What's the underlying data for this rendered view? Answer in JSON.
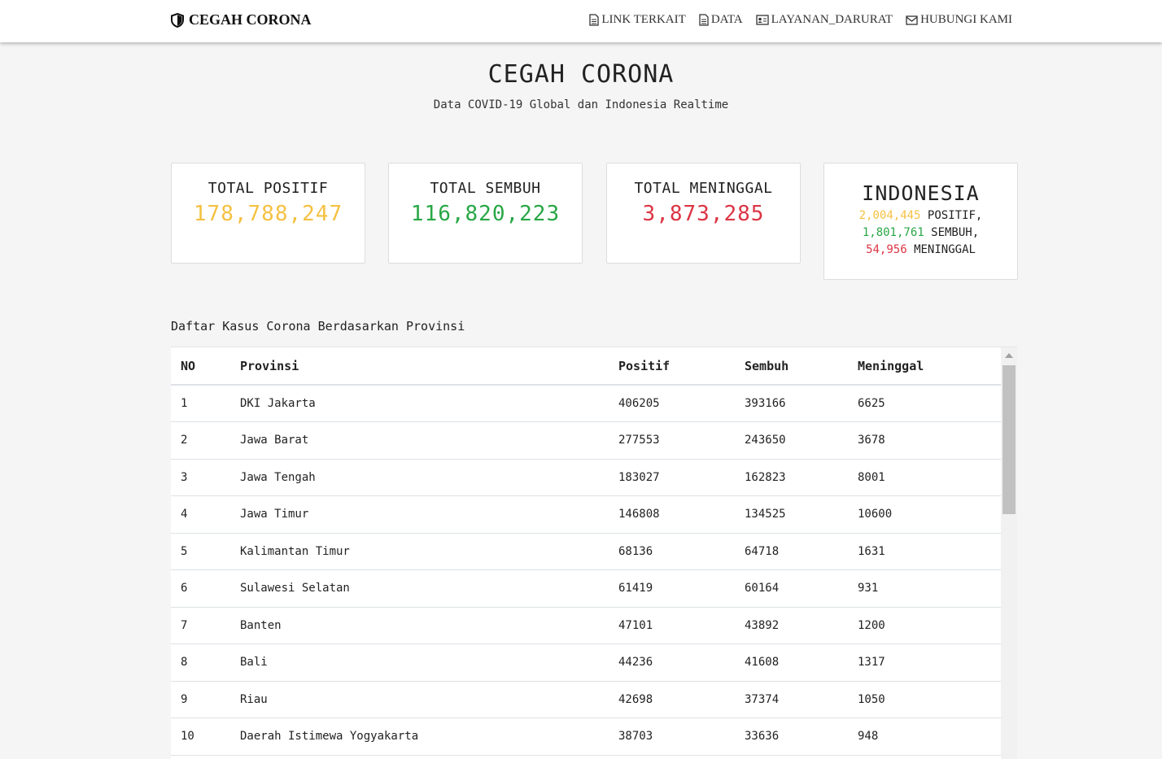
{
  "nav": {
    "brand": "CEGAH CORONA",
    "links": [
      {
        "label": "LINK TERKAIT",
        "icon": "file-icon"
      },
      {
        "label": "DATA",
        "icon": "file-icon"
      },
      {
        "label": "LAYANAN_DARURAT",
        "icon": "id-card-icon"
      },
      {
        "label": "HUBUNGI KAMI",
        "icon": "envelope-icon"
      }
    ]
  },
  "hero": {
    "title": "CEGAH CORONA",
    "subtitle": "Data COVID-19 Global dan Indonesia Realtime"
  },
  "colors": {
    "positive": "#f5c142",
    "recovered": "#28a745",
    "deaths": "#dc3545"
  },
  "global": {
    "positive_label": "TOTAL POSITIF",
    "positive_value": "178,788,247",
    "recovered_label": "TOTAL SEMBUH",
    "recovered_value": "116,820,223",
    "deaths_label": "TOTAL MENINGGAL",
    "deaths_value": "3,873,285"
  },
  "indonesia": {
    "title": "INDONESIA",
    "positive_value": "2,004,445",
    "positive_label": "POSITIF,",
    "recovered_value": "1,801,761",
    "recovered_label": "SEMBUH,",
    "deaths_value": "54,956",
    "deaths_label": "MENINGGAL"
  },
  "table": {
    "title": "Daftar Kasus Corona Berdasarkan Provinsi",
    "headers": [
      "NO",
      "Provinsi",
      "Positif",
      "Sembuh",
      "Meninggal"
    ],
    "rows": [
      [
        "1",
        "DKI Jakarta",
        "406205",
        "393166",
        "6625"
      ],
      [
        "2",
        "Jawa Barat",
        "277553",
        "243650",
        "3678"
      ],
      [
        "3",
        "Jawa Tengah",
        "183027",
        "162823",
        "8001"
      ],
      [
        "4",
        "Jawa Timur",
        "146808",
        "134525",
        "10600"
      ],
      [
        "5",
        "Kalimantan Timur",
        "68136",
        "64718",
        "1631"
      ],
      [
        "6",
        "Sulawesi Selatan",
        "61419",
        "60164",
        "931"
      ],
      [
        "7",
        "Banten",
        "47101",
        "43892",
        "1200"
      ],
      [
        "8",
        "Bali",
        "44236",
        "41608",
        "1317"
      ],
      [
        "9",
        "Riau",
        "42698",
        "37374",
        "1050"
      ],
      [
        "10",
        "Daerah Istimewa Yogyakarta",
        "38703",
        "33636",
        "948"
      ]
    ]
  }
}
